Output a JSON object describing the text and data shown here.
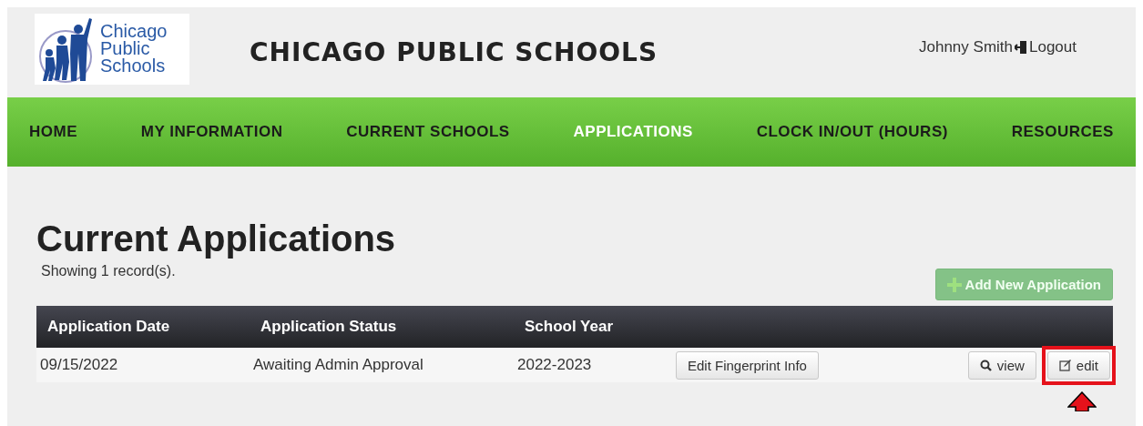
{
  "header": {
    "logo_text": [
      "Chicago",
      "Public",
      "Schools"
    ],
    "title": "CHICAGO PUBLIC SCHOOLS",
    "user": "Johnny Smith",
    "logout": "Logout"
  },
  "nav": [
    {
      "label": "HOME",
      "selected": false
    },
    {
      "label": "MY INFORMATION",
      "selected": false
    },
    {
      "label": "CURRENT SCHOOLS",
      "selected": false
    },
    {
      "label": "APPLICATIONS",
      "selected": true
    },
    {
      "label": "CLOCK IN/OUT (HOURS)",
      "selected": false
    },
    {
      "label": "RESOURCES",
      "selected": false
    }
  ],
  "page": {
    "title": "Current Applications",
    "record_count": "Showing 1 record(s).",
    "add_button": "Add New Application"
  },
  "table": {
    "columns": [
      "Application Date",
      "Application Status",
      "School Year"
    ],
    "rows": [
      {
        "cells": [
          "09/15/2022",
          "Awaiting Admin Approval",
          "2022-2023"
        ],
        "fingerprint_button": "Edit Fingerprint Info",
        "view_button": "view",
        "edit_button": "edit",
        "edit_highlighted": true
      }
    ]
  }
}
